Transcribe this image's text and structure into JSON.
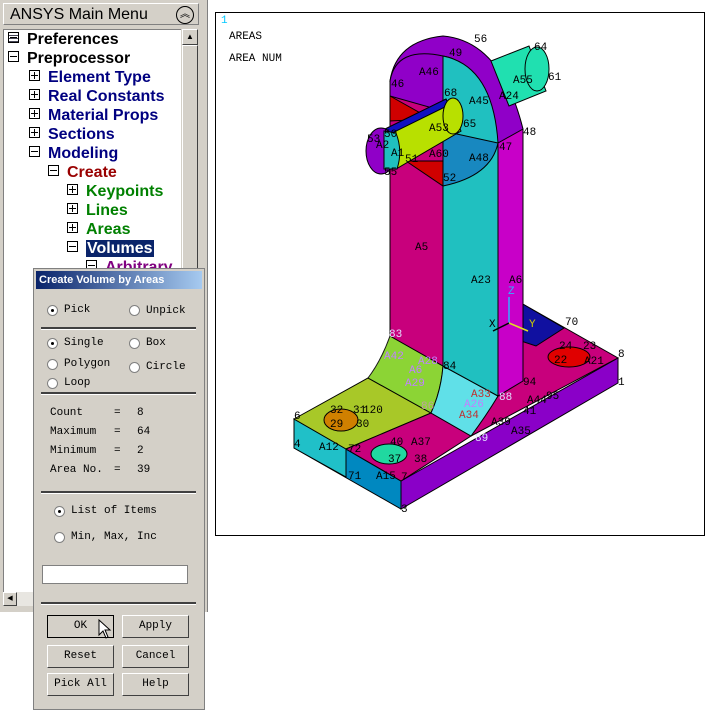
{
  "main_menu": {
    "title": "ANSYS Main Menu",
    "collapse_icon": "double-chevron-up-icon",
    "tree": [
      {
        "label": "Preferences",
        "icon": "preferences-icon",
        "color": "#000000"
      },
      {
        "label": "Preprocessor",
        "icon": "minus-box",
        "color": "#000000"
      },
      {
        "label": "Element Type",
        "icon": "plus-box",
        "color": "#000080"
      },
      {
        "label": "Real Constants",
        "icon": "plus-box",
        "color": "#000080"
      },
      {
        "label": "Material Props",
        "icon": "plus-box",
        "color": "#000080"
      },
      {
        "label": "Sections",
        "icon": "plus-box",
        "color": "#000080"
      },
      {
        "label": "Modeling",
        "icon": "minus-box",
        "color": "#000080"
      },
      {
        "label": "Create",
        "icon": "minus-box",
        "color": "#990000"
      },
      {
        "label": "Keypoints",
        "icon": "plus-box",
        "color": "#008000"
      },
      {
        "label": "Lines",
        "icon": "plus-box",
        "color": "#008000"
      },
      {
        "label": "Areas",
        "icon": "plus-box",
        "color": "#008000"
      },
      {
        "label": "Volumes",
        "icon": "minus-box",
        "color": "#ffffff",
        "selected": true
      },
      {
        "label": "Arbitrary",
        "icon": "minus-box",
        "color": "#800080"
      }
    ]
  },
  "dialog": {
    "title": "Create Volume by Areas",
    "mode": {
      "pick": "Pick",
      "unpick": "Unpick",
      "selected": "Pick"
    },
    "shape": {
      "single": "Single",
      "box": "Box",
      "polygon": "Polygon",
      "circle": "Circle",
      "loop": "Loop",
      "selected": "Single"
    },
    "stats": [
      {
        "label": "Count",
        "eq": "=",
        "value": "8"
      },
      {
        "label": "Maximum",
        "eq": "=",
        "value": "64"
      },
      {
        "label": "Minimum",
        "eq": "=",
        "value": "2"
      },
      {
        "label": "Area No.",
        "eq": "=",
        "value": "39"
      }
    ],
    "entry": {
      "list": "List of Items",
      "minmax": "Min, Max, Inc",
      "selected": "List of Items"
    },
    "input_value": "",
    "buttons": {
      "ok": "OK",
      "apply": "Apply",
      "reset": "Reset",
      "cancel": "Cancel",
      "pick_all": "Pick All",
      "help": "Help"
    }
  },
  "viewport": {
    "window_number": "1",
    "title1": "AREAS",
    "title2": "AREA NUM",
    "axes": {
      "x": "X",
      "y": "Y",
      "z": "Z"
    },
    "labels": [
      "56",
      "49",
      "64",
      "61",
      "A46",
      "46",
      "68",
      "A45",
      "A24",
      "A55",
      "A53",
      "65",
      "50",
      "53",
      "A2",
      "A1",
      "51",
      "A60",
      "A48",
      "47",
      "48",
      "52",
      "55",
      "A5",
      "A23",
      "A6",
      "70",
      "83",
      "A42",
      "A28",
      "84",
      "A6",
      "A29",
      "24",
      "23",
      "8",
      "A21",
      "22",
      "1",
      "94",
      "95",
      "A44",
      "41",
      "A33",
      "A26",
      "88",
      "A34",
      "86",
      "32",
      "31",
      "120",
      "29",
      "30",
      "6",
      "A39",
      "89",
      "A35",
      "40",
      "A37",
      "38",
      "37",
      "4",
      "A12",
      "72",
      "71",
      "A15",
      "7",
      "3"
    ]
  }
}
